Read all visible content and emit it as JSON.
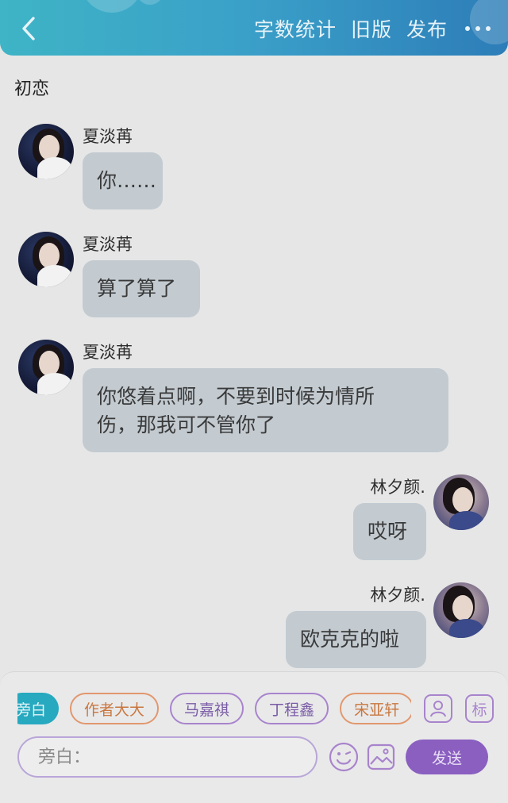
{
  "header": {
    "actions": [
      {
        "label": "字数统计"
      },
      {
        "label": "旧版"
      },
      {
        "label": "发布"
      }
    ]
  },
  "chat": {
    "title": "初恋",
    "messages": [
      {
        "side": "left",
        "sender": "夏淡苒",
        "text": "你……"
      },
      {
        "side": "left",
        "sender": "夏淡苒",
        "text": "算了算了"
      },
      {
        "side": "left",
        "sender": "夏淡苒",
        "text": "你悠着点啊，不要到时候为情所伤，那我可不管你了"
      },
      {
        "side": "right",
        "sender": "林夕颜.",
        "text": "哎呀"
      },
      {
        "side": "right",
        "sender": "林夕颜.",
        "text": "欧克克的啦"
      }
    ]
  },
  "composer": {
    "roles": [
      {
        "label": "旁白"
      },
      {
        "label": "作者大大"
      },
      {
        "label": "马嘉祺"
      },
      {
        "label": "丁程鑫"
      },
      {
        "label": "宋亚轩"
      }
    ],
    "tag_label": "标",
    "input_placeholder": "旁白：",
    "send_label": "发送"
  },
  "colors": {
    "header_start": "#3fb4c6",
    "header_end": "#2d7db8",
    "bubble": "#c3cbd1",
    "accent_purple": "#8a5fc0",
    "accent_orange": "#e1986e",
    "active_role": "#27a9c0"
  }
}
